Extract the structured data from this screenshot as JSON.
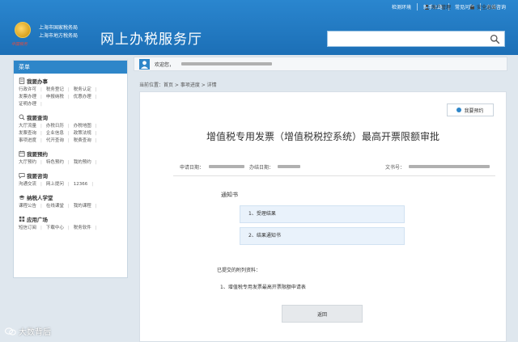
{
  "header": {
    "top_links": [
      "检测环境",
      "新手上路",
      "常见问题",
      "在线咨询"
    ],
    "agency_line1": "上海市国家税务局",
    "agency_line2": "上海市地方税务局",
    "emblem_caption": "中国税务",
    "site_name": "网上办税服务厅",
    "search_placeholder": ""
  },
  "sidebar": {
    "title": "菜单",
    "sections": [
      {
        "title": "我要办事",
        "icon": "document-icon",
        "links": [
          "行政许可",
          "税务登记",
          "税务认定",
          "发票办理",
          "申报纳税",
          "优惠办理",
          "证明办理"
        ]
      },
      {
        "title": "我要查询",
        "icon": "search-icon",
        "links": [
          "大厅流量",
          "办税日历",
          "办税地图",
          "发票查询",
          "企业信息",
          "政策法规",
          "事项进度",
          "代开查询",
          "税费查询"
        ]
      },
      {
        "title": "我要预约",
        "icon": "calendar-icon",
        "links": [
          "大厅预约",
          "特色预约",
          "我的预约"
        ]
      },
      {
        "title": "我要咨询",
        "icon": "chat-icon",
        "links": [
          "沟通交流",
          "网上提问",
          "12366"
        ]
      },
      {
        "title": "纳税人学堂",
        "icon": "graduation-icon",
        "links": [
          "课程公告",
          "在线课堂",
          "我的课程"
        ]
      },
      {
        "title": "应用广场",
        "icon": "grid-icon",
        "links": [
          "短信订阅",
          "下载中心",
          "税务软件"
        ]
      }
    ]
  },
  "userbar": {
    "welcome": "欢迎您，",
    "account": "账户管理",
    "security": "安全退出"
  },
  "breadcrumb": "当前位置：首页 > 事项进度 > 详情",
  "main": {
    "reserve_button": "我要预约",
    "title": "增值税专用发票（增值税税控系统）最高开票限额审批",
    "apply_date_label": "申请日期：",
    "process_date_label": "办结日期：",
    "doc_no_label": "文书号：",
    "notice_title": "通知书",
    "steps": [
      "1、受理结果",
      "2、结果通知书"
    ],
    "submitted_label": "已提交的附列资料：",
    "submitted_items": [
      "1、增值税专用发票最高开票限额申请表"
    ],
    "back_button": "返回"
  },
  "watermark": "大数背后",
  "colors": {
    "header_blue": "#1c6fb6",
    "accent_blue": "#2e86c9",
    "step_bg": "#e9f2fb"
  }
}
